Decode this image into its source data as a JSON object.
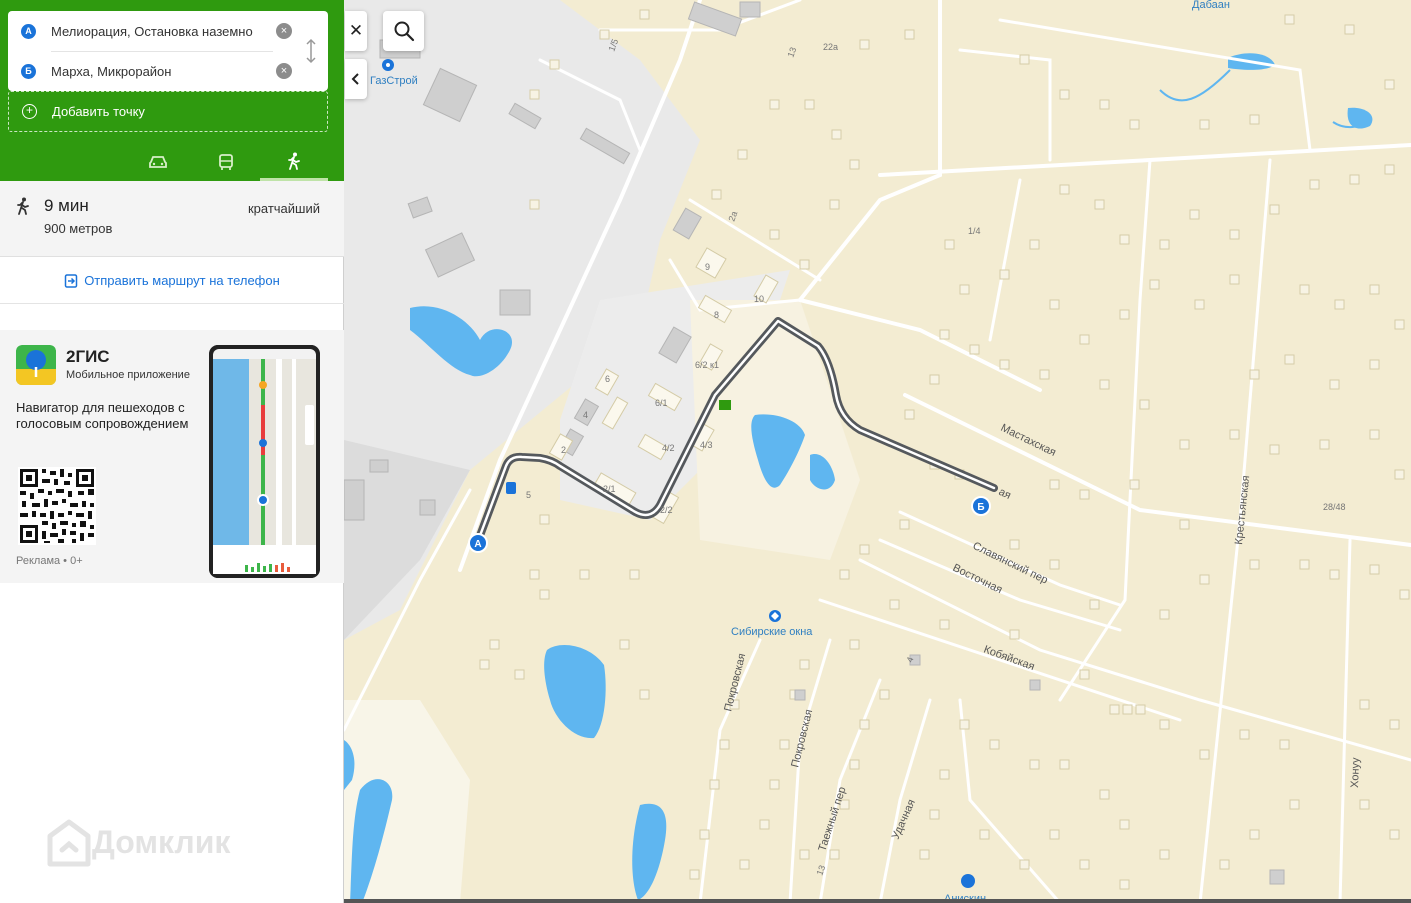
{
  "route": {
    "point_a": {
      "badge": "А",
      "text": "Мелиорация, Остановка наземно"
    },
    "point_b": {
      "badge": "Б",
      "text": "Марха, Микрорайон"
    },
    "add_point_label": "Добавить точку",
    "modes": [
      {
        "name": "car",
        "icon": "car-icon"
      },
      {
        "name": "public-transport",
        "icon": "bus-icon"
      },
      {
        "name": "walk",
        "icon": "walk-icon",
        "active": true
      }
    ]
  },
  "summary": {
    "time": "9 мин",
    "distance": "900 метров",
    "tag": "кратчайший"
  },
  "send_to_phone": "Отправить маршрут на телефон",
  "ad": {
    "brand": "2ГИС",
    "subtitle": "Мобильное приложение",
    "description": "Навигатор для пешеходов с голосовым сопровождением",
    "label": "Реклама • 0+"
  },
  "watermark": "Домклик",
  "map": {
    "labels": {
      "dabaan": "Дабаан",
      "gasstroy": "ГазСтрой",
      "mastakhskaya": "Мастахская",
      "slavyansky": "Славянский пер",
      "vostochnaya": "Восточная",
      "kobyayskaya": "Кобяйская",
      "krestyanskaya": "Крестьянская",
      "sibirskie": "Сибирские окна",
      "pokrovskaya1": "Покровская",
      "pokrovskaya2": "Покровская",
      "taezhny": "Таежный пер",
      "udachnaya": "Удачная",
      "khonuu": "Хонуу",
      "aniskin": "Анискин",
      "h13": "13",
      "h22a": "22а",
      "h15": "1/5",
      "h2a": "2а",
      "h14": "1/4",
      "h9": "9",
      "h10": "10",
      "h8": "8",
      "h62k1": "6/2 к1",
      "h61": "6/1",
      "h6": "6",
      "h4": "4",
      "h42": "4/2",
      "h43": "4/3",
      "h2": "2",
      "h21": "2/1",
      "h22": "2/2",
      "h5": "5",
      "h2848": "28/48",
      "h4b": "4",
      "h13b": "13",
      "marker_a": "А",
      "marker_b": "Б",
      "suffix_aya": "ая"
    },
    "colors": {
      "land": "#f3ecd2",
      "industrial": "#e9e9e9",
      "water": "#5fb6f0",
      "route": "#55595d",
      "marker": "#1a73d9"
    }
  }
}
